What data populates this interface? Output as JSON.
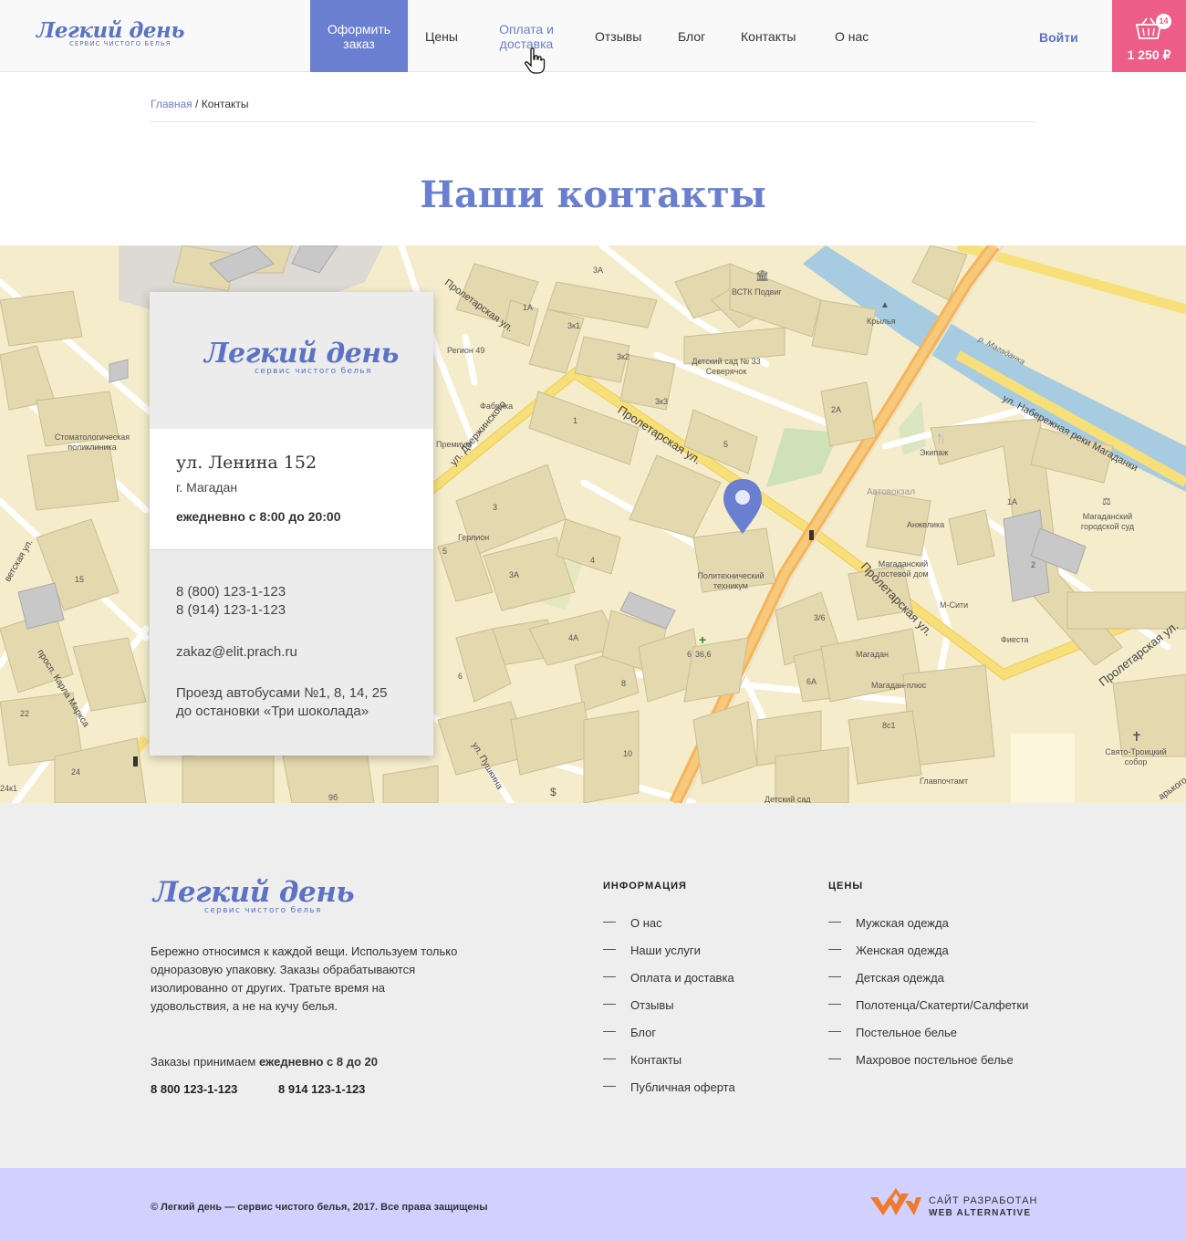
{
  "header": {
    "logo_title": "Легкий день",
    "logo_subtitle": "сервис чистого белья",
    "nav_order": "Оформить заказ",
    "nav": [
      "Цены",
      "Оплата и доставка",
      "Отзывы",
      "Блог",
      "Контакты",
      "О нас"
    ],
    "login": "Войти",
    "cart_count": "14",
    "cart_sum": "1 250 ₽"
  },
  "breadcrumb": {
    "home": "Главная",
    "separator": " / ",
    "current": "Контакты"
  },
  "page_title": "Наши контакты",
  "map": {
    "streets": [
      "Пролетарская ул.",
      "ул. Дзержинского",
      "Пролетарская ул.",
      "Пролетарская ул.",
      "ул. Набережная реки Магаданки",
      "р. Магаданка",
      "просп. Карла Маркса",
      "ул. Пушкина",
      "Пролетарская ул.",
      "ветская ул.",
      "арького"
    ],
    "pois": [
      "ВСТК Подвиг",
      "Крылья",
      "Детский сад № 33 Северячок",
      "Регион 49",
      "Фабрика",
      "Премиум",
      "Стоматологическая поликлиника",
      "Экипаж",
      "Автовокзал",
      "Анжелика",
      "Магаданский городской суд",
      "Герлион",
      "Политехнический техникум",
      "Магаданский гостевой дом",
      "М-Сити",
      "Фиеста",
      "Магадан",
      "Магадан-плюс",
      "Свято-Троицкий собор",
      "Главпочтамт",
      "Детский сад",
      "36,6"
    ],
    "numbers": [
      "3А",
      "1А",
      "3к1",
      "3к2",
      "3к3",
      "1",
      "5",
      "2А",
      "3",
      "5",
      "3А",
      "4",
      "4А",
      "6",
      "8",
      "10",
      "6А",
      "8с1",
      "3/6",
      "15",
      "22",
      "24",
      "9б",
      "24к1",
      "1А",
      "2",
      "6"
    ]
  },
  "card": {
    "logo_title": "Легкий день",
    "logo_subtitle": "сервис чистого белья",
    "address": "ул. Ленина 152",
    "city": "г. Магадан",
    "hours": "ежедневно с 8:00 до 20:00",
    "phone1": "8 (800) 123-1-123",
    "phone2": "8 (914) 123-1-123",
    "email": "zakaz@elit.prach.ru",
    "bus1": "Проезд автобусами №1, 8, 14, 25",
    "bus2": "до остановки «Три шоколада»"
  },
  "footer": {
    "logo_title": "Легкий день",
    "logo_subtitle": "сервис чистого белья",
    "description": "Бережно относимся к каждой вещи. Используем только одноразовую упаковку.  Заказы обрабатываются изолированно от других. Тратьте время на удовольствия, а не на кучу белья.",
    "orders_prefix": "Заказы  принимаем ",
    "orders_time": "ежедневно с 8 до 20",
    "phone1": "8 800 123-1-123",
    "phone2": "8 914  123-1-123",
    "info_title": "ИНФОРМАЦИЯ",
    "info_links": [
      "О нас",
      "Наши услуги",
      "Оплата и доставка",
      "Отзывы",
      "Блог",
      "Контакты",
      "Публичная оферта"
    ],
    "prices_title": "ЦЕНЫ",
    "prices_links": [
      "Мужская одежда",
      "Женская одежда",
      "Детская одежда",
      "Полотенца/Скатерти/Салфетки",
      "Постельное белье",
      "Махровое постельное белье"
    ]
  },
  "bottom": {
    "copyright": "© Легкий день — сервис чистого белья, 2017. Все права защищены",
    "dev_line1": "САЙТ РАЗРАБОТАН",
    "dev_line2": "WEB ALTERNATIVE"
  },
  "colors": {
    "accent": "#6a7fd0",
    "cart": "#ee5c88",
    "footer_bar": "#d1d0ff"
  }
}
